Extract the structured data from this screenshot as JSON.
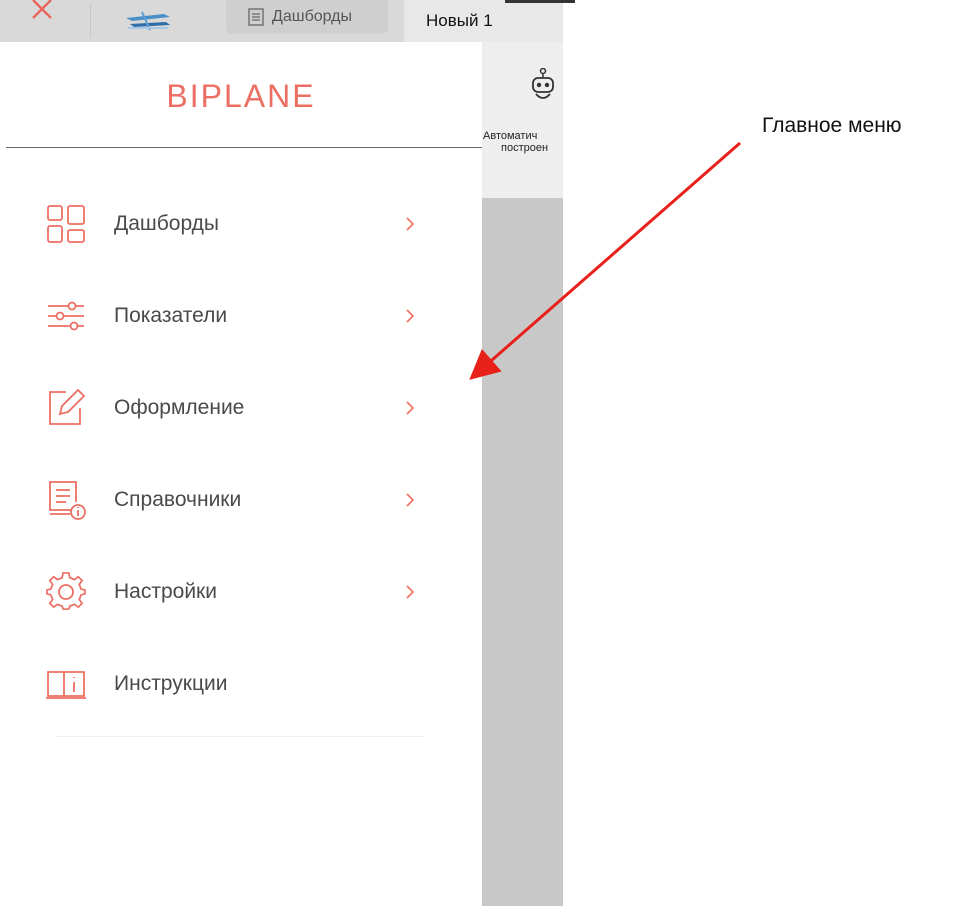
{
  "topbar": {
    "tab_dashboards_label": "Дашборды",
    "tab_new_label": "Новый 1"
  },
  "sidebar": {
    "brand": "BIPLANE",
    "items": [
      {
        "label": "Дашборды",
        "icon": "dashboard-grid-icon",
        "has_chevron": true
      },
      {
        "label": "Показатели",
        "icon": "sliders-icon",
        "has_chevron": true
      },
      {
        "label": "Оформление",
        "icon": "edit-square-icon",
        "has_chevron": true
      },
      {
        "label": "Справочники",
        "icon": "reference-book-icon",
        "has_chevron": true
      },
      {
        "label": "Настройки",
        "icon": "gear-icon",
        "has_chevron": true
      },
      {
        "label": "Инструкции",
        "icon": "open-book-info-icon",
        "has_chevron": false
      }
    ]
  },
  "toolbar": {
    "auto_line1": "Автоматич",
    "auto_line2": "построен"
  },
  "annotation": {
    "text": "Главное меню"
  },
  "colors": {
    "accent": "#ec6f63",
    "arrow": "#e8201a",
    "panel_gray": "#c8c8c8",
    "topbar_gray": "#d9d9d9"
  }
}
